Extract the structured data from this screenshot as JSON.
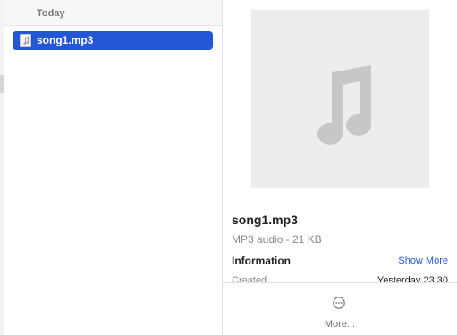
{
  "list": {
    "section_header": "Today",
    "items": [
      {
        "name": "song1.mp3",
        "selected": true,
        "icon": "music-file-icon"
      }
    ]
  },
  "preview": {
    "artwork_icon": "music-note-icon",
    "title": "song1.mp3",
    "subtitle": "MP3 audio - 21 KB",
    "info_heading": "Information",
    "show_more": "Show More",
    "info_rows": [
      {
        "label": "Created",
        "value": "Yesterday 23:30"
      }
    ],
    "more_button_label": "More...",
    "more_button_icon": "ellipsis-circle-icon"
  },
  "colors": {
    "selection": "#2457d6",
    "link": "#2457d6",
    "artwork_bg": "#ededed",
    "artwork_glyph": "#c7c7c7"
  }
}
